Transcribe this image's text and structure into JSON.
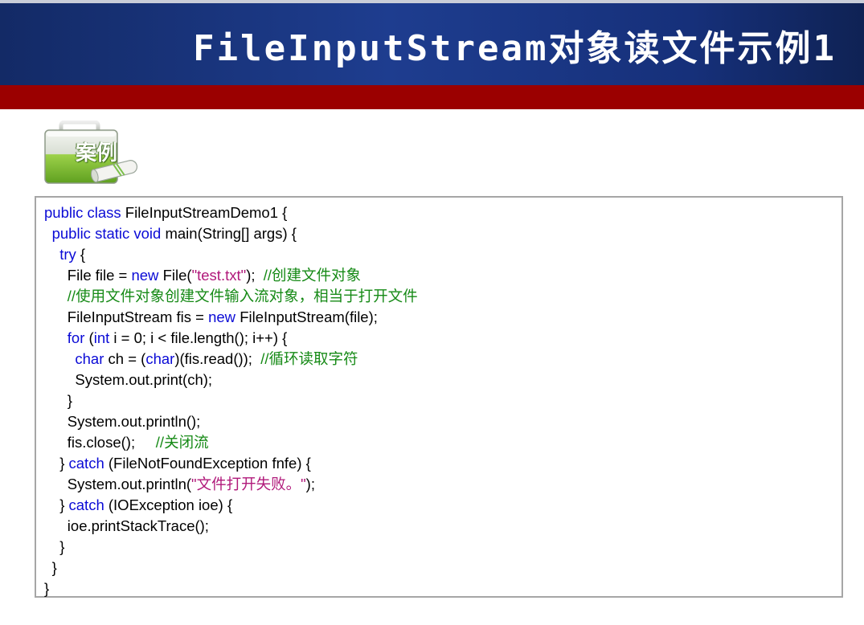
{
  "slide": {
    "title": "FileInputStream对象读文件示例1",
    "badge_label": "案例",
    "colors": {
      "title_bar": "#1e3d8f",
      "red_band": "#9b0000",
      "keyword": "#0b0bd6",
      "string": "#b0187a",
      "comment": "#168a16"
    }
  },
  "code": {
    "lines": [
      {
        "indent": 0,
        "tokens": [
          {
            "t": "kw",
            "v": "public class"
          },
          {
            "t": "pl",
            "v": " FileInputStreamDemo1 {"
          }
        ]
      },
      {
        "indent": 1,
        "tokens": [
          {
            "t": "kw",
            "v": "public static void"
          },
          {
            "t": "pl",
            "v": " main(String[] args) {"
          }
        ]
      },
      {
        "indent": 2,
        "tokens": [
          {
            "t": "kw",
            "v": "try"
          },
          {
            "t": "pl",
            "v": " {"
          }
        ]
      },
      {
        "indent": 3,
        "tokens": [
          {
            "t": "pl",
            "v": "File file = "
          },
          {
            "t": "kw",
            "v": "new"
          },
          {
            "t": "pl",
            "v": " File("
          },
          {
            "t": "str",
            "v": "\"test.txt\""
          },
          {
            "t": "pl",
            "v": ");  "
          },
          {
            "t": "cm",
            "v": "//创建文件对象"
          }
        ]
      },
      {
        "indent": 3,
        "tokens": [
          {
            "t": "cm",
            "v": "//使用文件对象创建文件输入流对象，相当于打开文件"
          }
        ]
      },
      {
        "indent": 3,
        "tokens": [
          {
            "t": "pl",
            "v": "FileInputStream fis = "
          },
          {
            "t": "kw",
            "v": "new"
          },
          {
            "t": "pl",
            "v": " FileInputStream(file);"
          }
        ]
      },
      {
        "indent": 3,
        "tokens": [
          {
            "t": "kw",
            "v": "for"
          },
          {
            "t": "pl",
            "v": " ("
          },
          {
            "t": "kw",
            "v": "int"
          },
          {
            "t": "pl",
            "v": " i = 0; i < file.length(); i++) {"
          }
        ]
      },
      {
        "indent": 4,
        "tokens": [
          {
            "t": "kw",
            "v": "char"
          },
          {
            "t": "pl",
            "v": " ch = ("
          },
          {
            "t": "kw",
            "v": "char"
          },
          {
            "t": "pl",
            "v": ")(fis.read());  "
          },
          {
            "t": "cm",
            "v": "//循环读取字符"
          }
        ]
      },
      {
        "indent": 4,
        "tokens": [
          {
            "t": "pl",
            "v": "System.out.print(ch);"
          }
        ]
      },
      {
        "indent": 3,
        "tokens": [
          {
            "t": "pl",
            "v": "}"
          }
        ]
      },
      {
        "indent": 3,
        "tokens": [
          {
            "t": "pl",
            "v": "System.out.println();"
          }
        ]
      },
      {
        "indent": 3,
        "tokens": [
          {
            "t": "pl",
            "v": "fis.close();     "
          },
          {
            "t": "cm",
            "v": "//关闭流"
          }
        ]
      },
      {
        "indent": 2,
        "tokens": [
          {
            "t": "pl",
            "v": "} "
          },
          {
            "t": "kw",
            "v": "catch"
          },
          {
            "t": "pl",
            "v": " (FileNotFoundException fnfe) {"
          }
        ]
      },
      {
        "indent": 3,
        "tokens": [
          {
            "t": "pl",
            "v": "System.out.println("
          },
          {
            "t": "str",
            "v": "\"文件打开失败。\""
          },
          {
            "t": "pl",
            "v": ");"
          }
        ]
      },
      {
        "indent": 2,
        "tokens": [
          {
            "t": "pl",
            "v": "} "
          },
          {
            "t": "kw",
            "v": "catch"
          },
          {
            "t": "pl",
            "v": " (IOException ioe) {"
          }
        ]
      },
      {
        "indent": 3,
        "tokens": [
          {
            "t": "pl",
            "v": "ioe.printStackTrace();"
          }
        ]
      },
      {
        "indent": 2,
        "tokens": [
          {
            "t": "pl",
            "v": "}"
          }
        ]
      },
      {
        "indent": 1,
        "tokens": [
          {
            "t": "pl",
            "v": "}"
          }
        ]
      },
      {
        "indent": 0,
        "tokens": [
          {
            "t": "pl",
            "v": "}"
          }
        ]
      }
    ]
  }
}
